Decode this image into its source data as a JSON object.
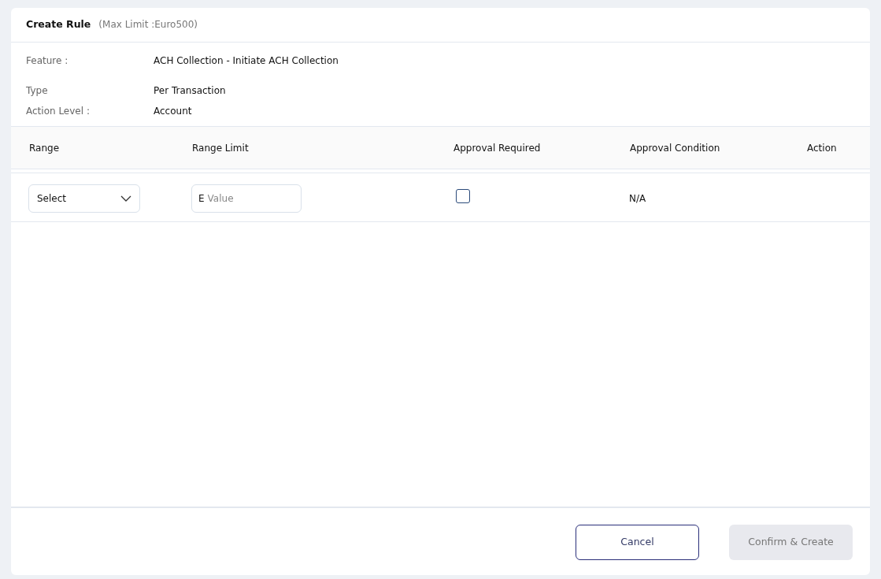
{
  "header": {
    "title": "Create Rule",
    "subtitle": "(Max Limit :Euro500)"
  },
  "details": [
    {
      "label": "Feature :",
      "value": "ACH Collection - Initiate ACH Collection"
    },
    {
      "label": "Type",
      "value": "Per Transaction"
    },
    {
      "label": "Action Level :",
      "value": "Account"
    }
  ],
  "table": {
    "columns": [
      "Range",
      "Range Limit",
      "Approval Required",
      "Approval Condition",
      "Action"
    ],
    "rows": [
      {
        "range": {
          "value": "Select"
        },
        "range_limit": {
          "prefix": "E",
          "placeholder": "Value"
        },
        "approval_required": {
          "checked": false
        },
        "approval_condition": "N/A"
      }
    ]
  },
  "buttons": [
    {
      "label": "Cancel",
      "kind": "secondary",
      "disabled": false
    },
    {
      "label": "Confirm & Create",
      "kind": "primary",
      "disabled": true
    }
  ]
}
